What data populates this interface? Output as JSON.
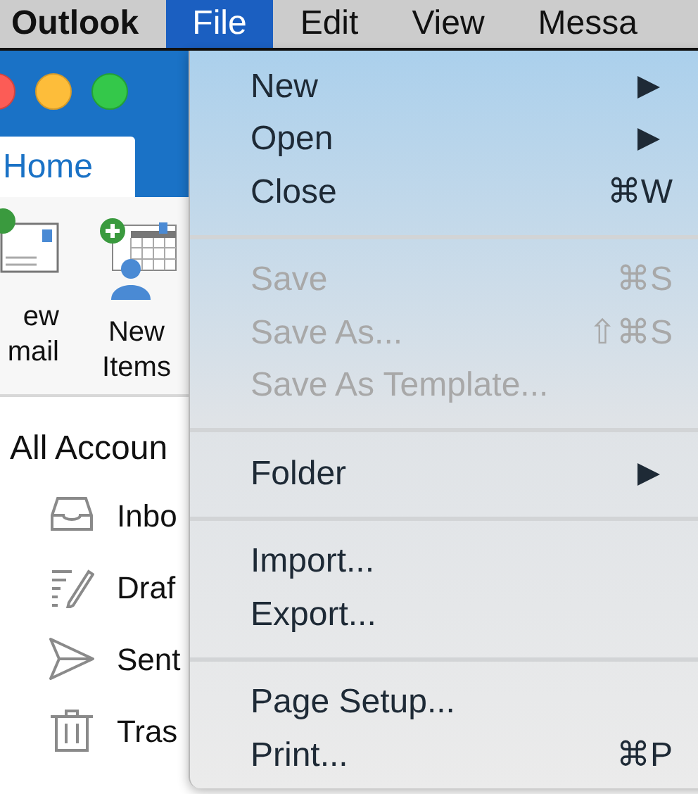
{
  "menubar": [
    {
      "label": "Outlook",
      "kind": "app",
      "selected": false
    },
    {
      "label": "File",
      "kind": "menu",
      "selected": true
    },
    {
      "label": "Edit",
      "kind": "menu",
      "selected": false
    },
    {
      "label": "View",
      "kind": "menu",
      "selected": false
    },
    {
      "label": "Messa",
      "kind": "menu",
      "selected": false
    }
  ],
  "ribbon": {
    "tab": "Home",
    "buttons": [
      {
        "lines": [
          "ew",
          "mail"
        ],
        "kind": "email"
      },
      {
        "lines": [
          "New",
          "Items"
        ],
        "kind": "items"
      }
    ]
  },
  "sidebar": {
    "account": "All Accoun",
    "folders": [
      {
        "label": "Inbo",
        "kind": "inbox"
      },
      {
        "label": "Draf",
        "kind": "drafts"
      },
      {
        "label": "Sent",
        "kind": "sent"
      },
      {
        "label": "Tras",
        "kind": "trash"
      }
    ]
  },
  "file_menu": [
    [
      {
        "label": "New",
        "submenu": true,
        "disabled": false
      },
      {
        "label": "Open",
        "submenu": true,
        "disabled": false
      },
      {
        "label": "Close",
        "shortcut": "⌘W",
        "submenu": false,
        "disabled": false
      }
    ],
    [
      {
        "label": "Save",
        "shortcut": "⌘S",
        "submenu": false,
        "disabled": true
      },
      {
        "label": "Save As...",
        "shortcut": "⇧⌘S",
        "submenu": false,
        "disabled": true
      },
      {
        "label": "Save As Template...",
        "submenu": false,
        "disabled": true
      }
    ],
    [
      {
        "label": "Folder",
        "submenu": true,
        "disabled": false
      }
    ],
    [
      {
        "label": "Import...",
        "submenu": false,
        "disabled": false
      },
      {
        "label": "Export...",
        "submenu": false,
        "disabled": false
      }
    ],
    [
      {
        "label": "Page Setup...",
        "submenu": false,
        "disabled": false
      },
      {
        "label": "Print...",
        "shortcut": "⌘P",
        "submenu": false,
        "disabled": false
      }
    ]
  ]
}
